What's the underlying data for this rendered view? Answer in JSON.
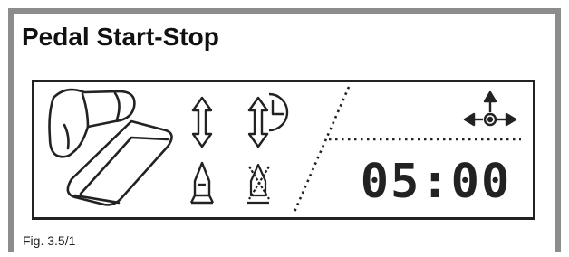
{
  "figure": {
    "title": "Pedal Start-Stop",
    "caption": "Fig. 3.5/1"
  },
  "display": {
    "time_value": "05:00",
    "icons": [
      "foot-pedal-icon",
      "vertical-arrow-icon",
      "vertical-arrow-timer-icon",
      "flame-icon",
      "flame-crossed-icon",
      "sensor-arrows-icon"
    ],
    "colors": {
      "frame": "#8c8c8c",
      "lcd_ink": "#222222",
      "background": "#ffffff"
    }
  }
}
